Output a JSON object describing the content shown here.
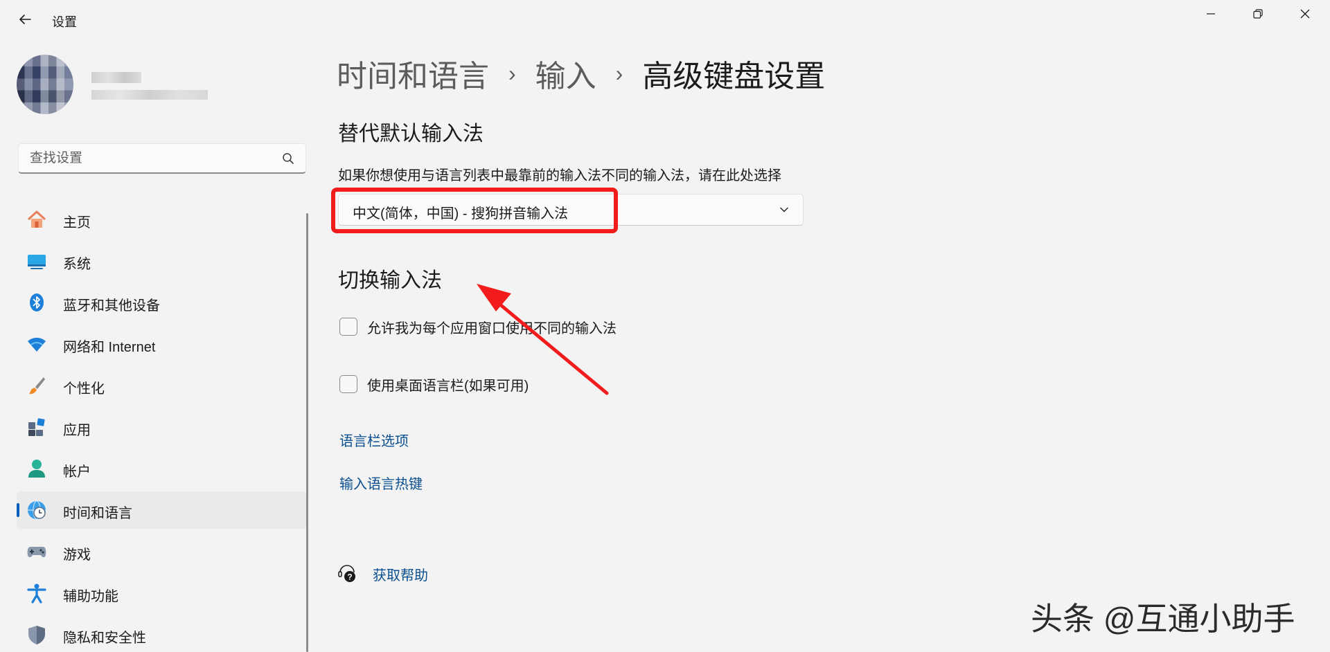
{
  "window": {
    "title": "设置"
  },
  "search": {
    "placeholder": "查找设置"
  },
  "sidebar": {
    "items": [
      {
        "label": "主页",
        "icon": "home-icon"
      },
      {
        "label": "系统",
        "icon": "system-icon"
      },
      {
        "label": "蓝牙和其他设备",
        "icon": "bluetooth-icon"
      },
      {
        "label": "网络和 Internet",
        "icon": "wifi-icon"
      },
      {
        "label": "个性化",
        "icon": "brush-icon"
      },
      {
        "label": "应用",
        "icon": "apps-icon"
      },
      {
        "label": "帐户",
        "icon": "account-icon"
      },
      {
        "label": "时间和语言",
        "icon": "time-language-icon",
        "active": true
      },
      {
        "label": "游戏",
        "icon": "gamepad-icon"
      },
      {
        "label": "辅助功能",
        "icon": "accessibility-icon"
      },
      {
        "label": "隐私和安全性",
        "icon": "shield-icon"
      }
    ]
  },
  "breadcrumb": {
    "level1": "时间和语言",
    "level2": "输入",
    "current": "高级键盘设置",
    "separator": "›"
  },
  "override": {
    "title": "替代默认输入法",
    "description": "如果你想使用与语言列表中最靠前的输入法不同的输入法，请在此处选择",
    "selected": "中文(简体，中国) - 搜狗拼音输入法"
  },
  "switch": {
    "title": "切换输入法",
    "option1": "允许我为每个应用窗口使用不同的输入法",
    "option2": "使用桌面语言栏(如果可用)",
    "option1_checked": false,
    "option2_checked": false
  },
  "links": {
    "language_bar": "语言栏选项",
    "hotkeys": "输入语言热键",
    "help": "获取帮助"
  },
  "watermark": "头条 @互通小助手",
  "colors": {
    "accent": "#005fb8",
    "link": "#0a4f8f",
    "annotation": "#f21c1c",
    "background": "#f3f3f3"
  }
}
